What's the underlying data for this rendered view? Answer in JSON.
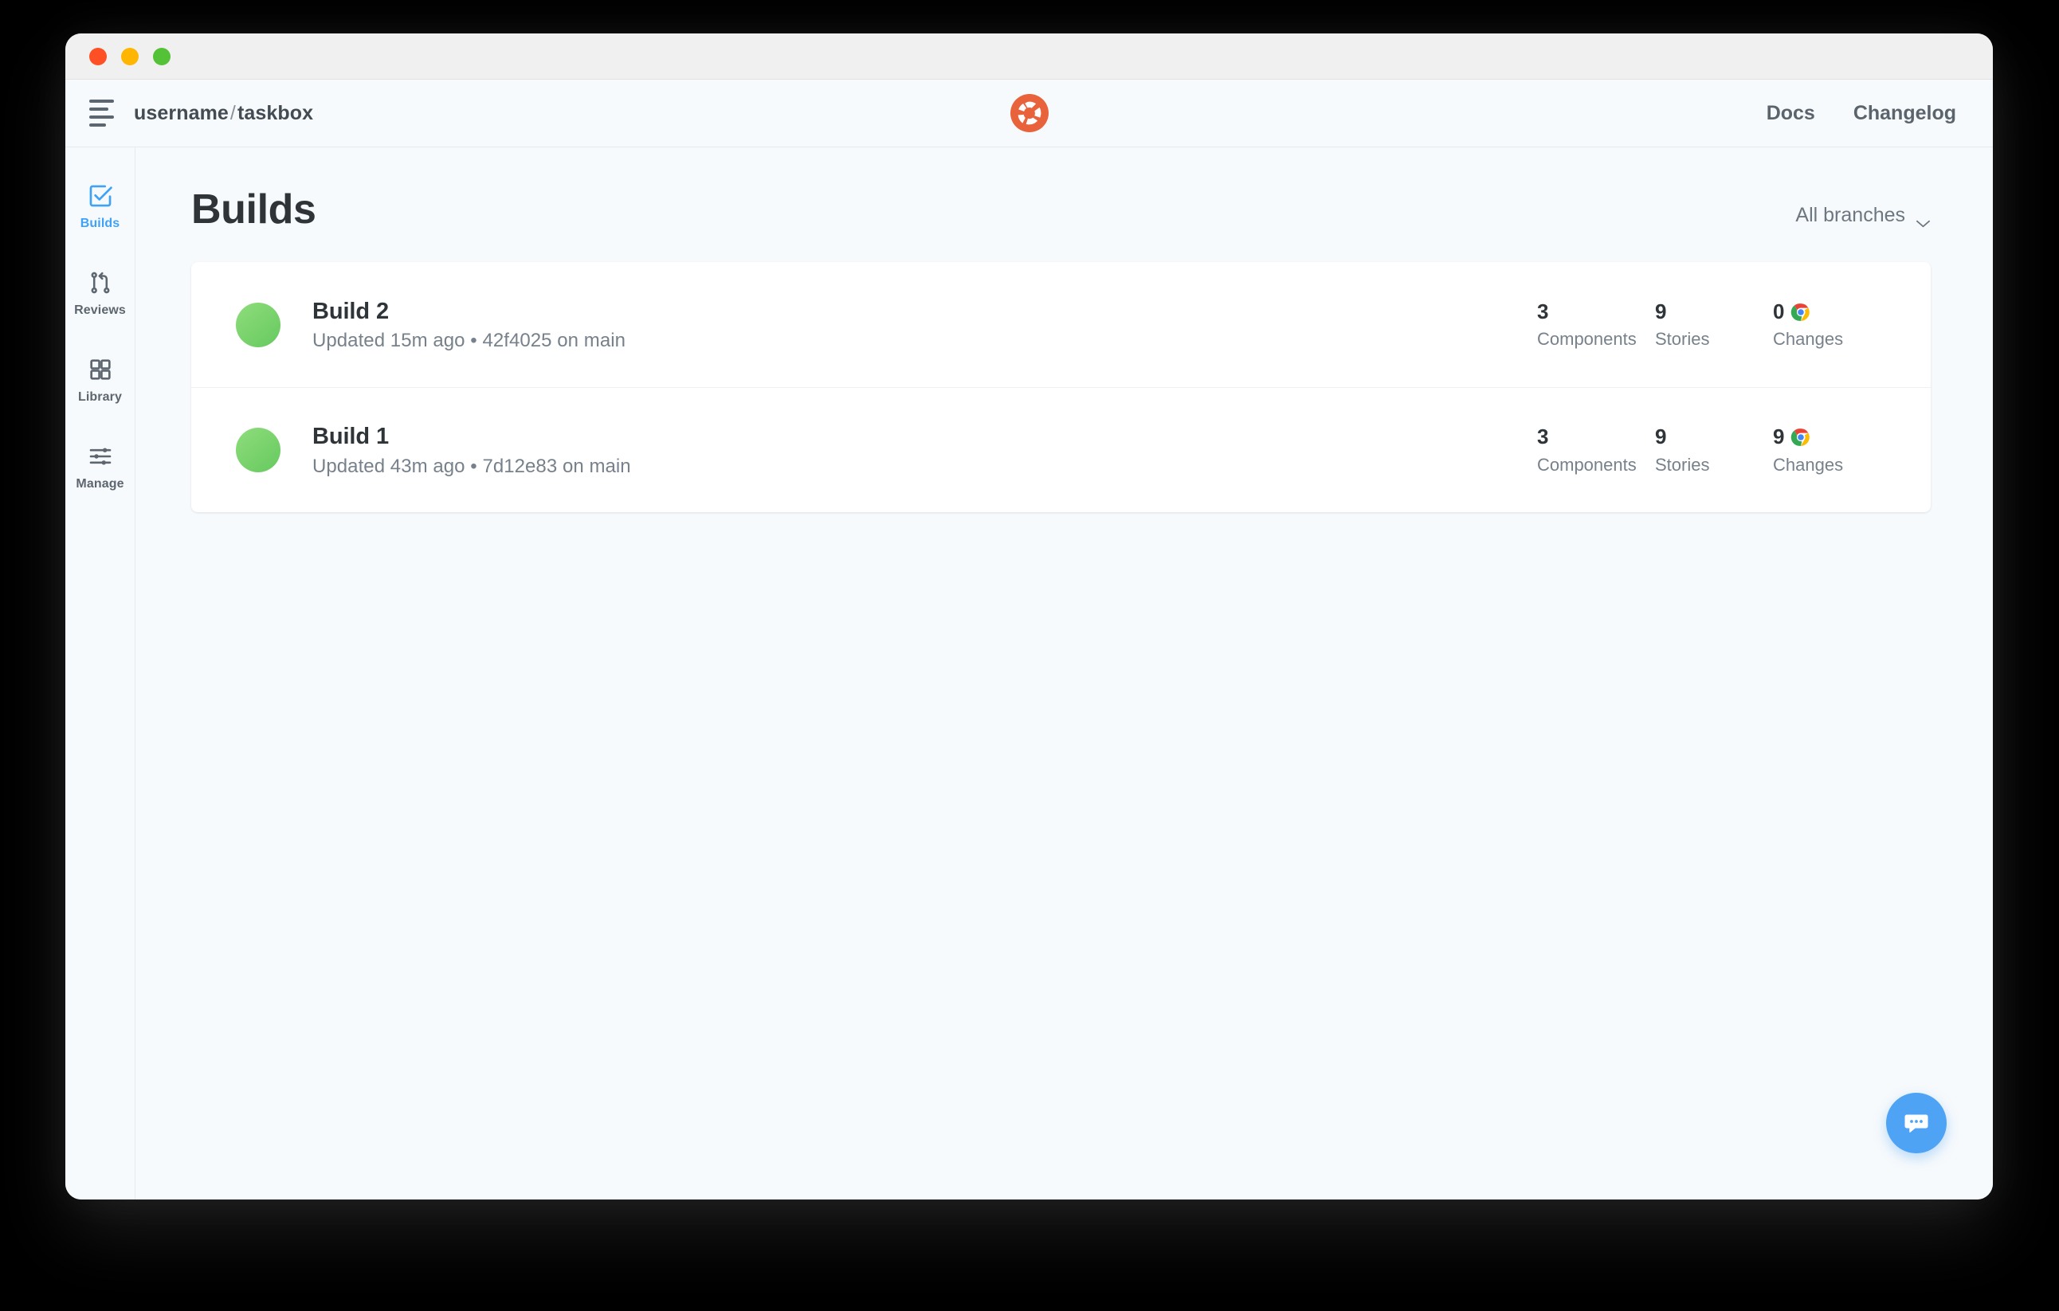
{
  "window": {
    "traffic_lights": [
      "close",
      "minimize",
      "maximize"
    ]
  },
  "appbar": {
    "menu_icon": "hamburger-icon",
    "repo_owner": "username",
    "repo_separator": "/",
    "repo_name": "taskbox",
    "logo": "chromatic-logo",
    "links": [
      {
        "label": "Docs"
      },
      {
        "label": "Changelog"
      }
    ]
  },
  "sidebar": {
    "items": [
      {
        "label": "Builds",
        "icon": "checkbox-check-icon",
        "active": true
      },
      {
        "label": "Reviews",
        "icon": "pull-request-icon",
        "active": false
      },
      {
        "label": "Library",
        "icon": "grid-squares-icon",
        "active": false
      },
      {
        "label": "Manage",
        "icon": "sliders-icon",
        "active": false
      }
    ]
  },
  "main": {
    "title": "Builds",
    "branch_filter": {
      "label": "All branches",
      "icon": "chevron-down-icon"
    },
    "stat_labels": {
      "components": "Components",
      "stories": "Stories",
      "changes": "Changes"
    },
    "builds": [
      {
        "name": "Build 2",
        "subtitle": "Updated 15m ago • 42f4025 on main",
        "status": "passed",
        "status_color": "#6ece63",
        "components": "3",
        "stories": "9",
        "changes": "0",
        "browser_icon": "chrome-icon"
      },
      {
        "name": "Build 1",
        "subtitle": "Updated 43m ago • 7d12e83 on main",
        "status": "passed",
        "status_color": "#6ece63",
        "components": "3",
        "stories": "9",
        "changes": "9",
        "browser_icon": "chrome-icon"
      }
    ]
  },
  "chat": {
    "icon": "chat-bubble-icon",
    "accent_color": "#4fa3f4"
  },
  "colors": {
    "page_background": "#f7fafc",
    "card_background": "#ffffff",
    "active_nav": "#3fa2f7",
    "brand_orange": "#e8623c",
    "status_green": "#6ece63"
  }
}
